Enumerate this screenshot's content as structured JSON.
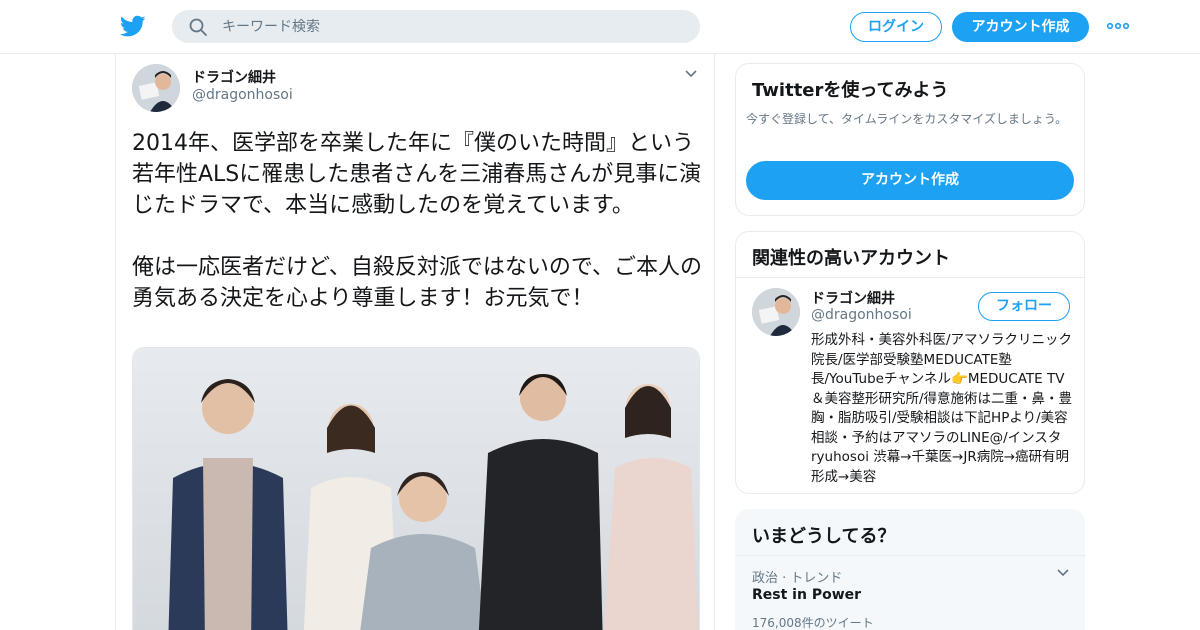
{
  "header": {
    "search_placeholder": "キーワード検索",
    "login_label": "ログイン",
    "signup_label": "アカウント作成",
    "icons": [
      "twitter-bird-icon",
      "search-icon",
      "more-dots-icon"
    ],
    "accent_color": "#1da1f2"
  },
  "tweet": {
    "author_name": "ドラゴン細井",
    "author_handle": "@dragonhosoi",
    "text": "2014年、医学部を卒業した年に『僕のいた時間』という若年性ALSに罹患した患者さんを三浦春馬さんが見事に演じたドラマで、本当に感動したのを覚えています。\n\n俺は一応医者だけど、自殺反対派ではないので、ご本人の勇気ある決定を心より尊重します！お元気で！"
  },
  "sidebar": {
    "signup_card": {
      "title": "Twitterを使ってみよう",
      "description": "今すぐ登録して、タイムラインをカスタマイズしましょう。",
      "cta_label": "アカウント作成"
    },
    "related_card": {
      "title": "関連性の高いアカウント",
      "account": {
        "name": "ドラゴン細井",
        "handle": "@dragonhosoi",
        "follow_label": "フォロー",
        "bio": "形成外科・美容外科医/アマソラクリニック院長/医学部受験塾MEDUCATE塾長/YouTubeチャンネル👉MEDUCATE TV＆美容整形研究所/得意施術は二重・鼻・豊胸・脂肪吸引/受験相談は下記HPより/美容相談・予約はアマソラのLINE@/インスタryuhosoi 渋幕→千葉医→JR病院→癌研有明形成→美容"
      }
    },
    "trends_card": {
      "title": "いまどうしてる？",
      "trend": {
        "category": "政治 · トレンド",
        "name": "Rest in Power",
        "count": "176,008件のツイート"
      }
    }
  }
}
